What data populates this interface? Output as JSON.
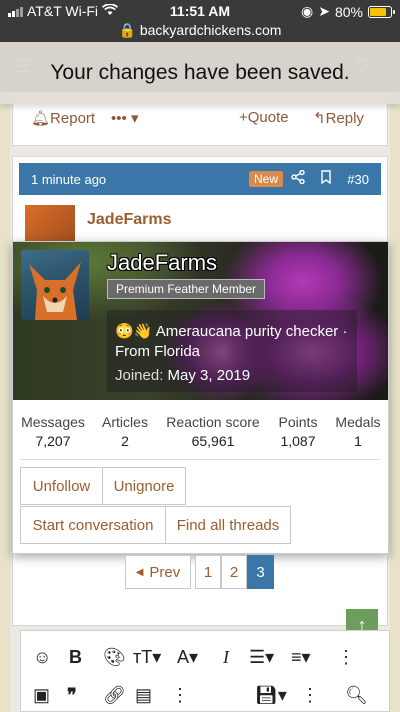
{
  "statusbar": {
    "carrier": "AT&T Wi-Fi",
    "time": "11:51 AM",
    "battery_pct": "80%",
    "battery_level": 0.8,
    "url": "backyardchickens.com"
  },
  "toast": {
    "message": "Your changes have been saved."
  },
  "prev_post_actions": {
    "report": "Report",
    "more": "•••",
    "quote": "Quote",
    "reply": "Reply"
  },
  "post": {
    "time_ago": "1 minute ago",
    "badge": "New",
    "number": "#30",
    "username": "JadeFarms"
  },
  "member_card": {
    "username": "JadeFarms",
    "user_title": "Premium Feather Member",
    "bio_emoji": "😳👋",
    "bio_text": "Ameraucana purity checker ·",
    "location": "From Florida",
    "joined_label": "Joined:",
    "joined_date": "May 3, 2019",
    "stats": [
      {
        "label": "Messages",
        "value": "7,207"
      },
      {
        "label": "Articles",
        "value": "2"
      },
      {
        "label": "Reaction score",
        "value": "65,961"
      },
      {
        "label": "Points",
        "value": "1,087"
      },
      {
        "label": "Medals",
        "value": "1"
      }
    ],
    "buttons": {
      "unfollow": "Unfollow",
      "unignore": "Unignore",
      "start_conversation": "Start conversation",
      "find_all_threads": "Find all threads"
    }
  },
  "pagination": {
    "prev": "Prev",
    "pages": [
      "1",
      "2",
      "3"
    ],
    "current": "3"
  },
  "colors": {
    "accent": "#3a77a8",
    "link": "#9b5e2e",
    "badge": "#d98b4c",
    "scroll_button": "#6a9e5a"
  },
  "editor_toolbar": {
    "icons": [
      "smiley-icon",
      "bold-icon",
      "palette-icon",
      "text-size-icon",
      "font-icon",
      "italic-icon",
      "list-icon",
      "align-icon",
      "more-icon",
      "image-icon",
      "quote-icon",
      "link-icon",
      "media-icon",
      "more-icon",
      "save-draft-icon",
      "more-icon",
      "preview-icon"
    ]
  }
}
